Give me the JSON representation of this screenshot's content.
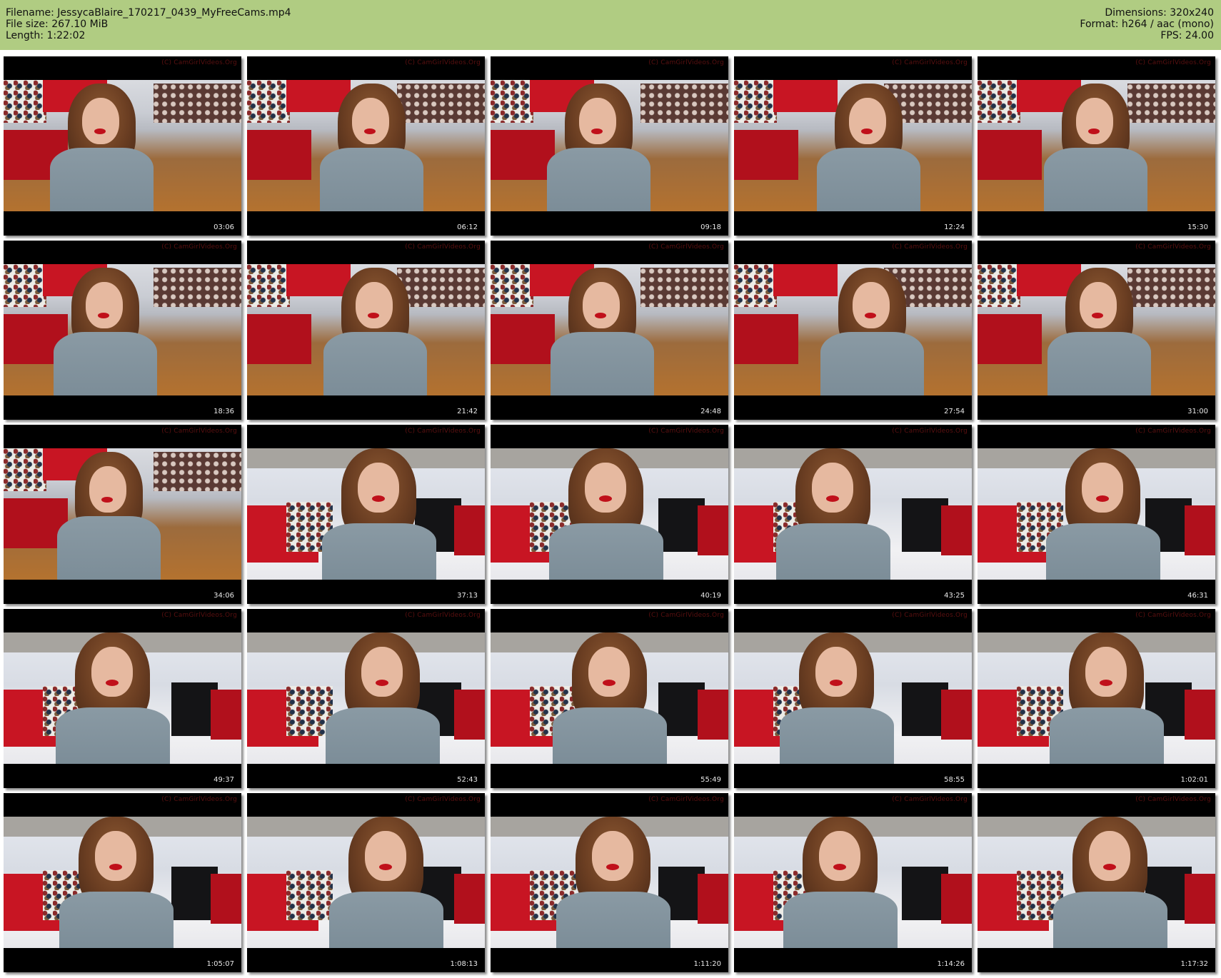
{
  "header": {
    "filename_line": "Filename: JessycaBlaire_170217_0439_MyFreeCams.mp4",
    "filesize_line": "File size: 267.10 MiB",
    "length_line": "Length: 1:22:02",
    "dimensions_line": "Dimensions: 320x240",
    "format_line": "Format: h264 / aac (mono)",
    "fps_line": "FPS: 24.00",
    "background_color": "#b0cc82"
  },
  "watermark_text": "(C) CamGirlVideos.Org",
  "thumbnails": [
    {
      "time": "03:06",
      "scene": "a"
    },
    {
      "time": "06:12",
      "scene": "a"
    },
    {
      "time": "09:18",
      "scene": "a"
    },
    {
      "time": "12:24",
      "scene": "a"
    },
    {
      "time": "15:30",
      "scene": "a"
    },
    {
      "time": "18:36",
      "scene": "a"
    },
    {
      "time": "21:42",
      "scene": "a"
    },
    {
      "time": "24:48",
      "scene": "a"
    },
    {
      "time": "27:54",
      "scene": "a"
    },
    {
      "time": "31:00",
      "scene": "a"
    },
    {
      "time": "34:06",
      "scene": "a"
    },
    {
      "time": "37:13",
      "scene": "b"
    },
    {
      "time": "40:19",
      "scene": "b"
    },
    {
      "time": "43:25",
      "scene": "b"
    },
    {
      "time": "46:31",
      "scene": "b"
    },
    {
      "time": "49:37",
      "scene": "b"
    },
    {
      "time": "52:43",
      "scene": "b"
    },
    {
      "time": "55:49",
      "scene": "b"
    },
    {
      "time": "58:55",
      "scene": "b"
    },
    {
      "time": "1:02:01",
      "scene": "b"
    },
    {
      "time": "1:05:07",
      "scene": "b"
    },
    {
      "time": "1:08:13",
      "scene": "b"
    },
    {
      "time": "1:11:20",
      "scene": "b"
    },
    {
      "time": "1:14:26",
      "scene": "b"
    },
    {
      "time": "1:17:32",
      "scene": "b"
    }
  ]
}
